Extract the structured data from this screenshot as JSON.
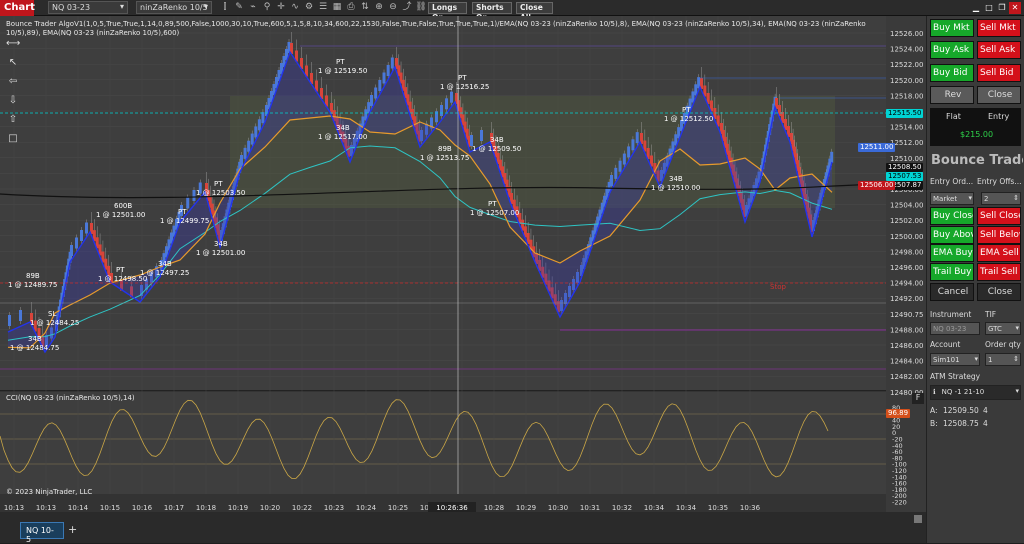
{
  "toolbar": {
    "chart_label": "Chart",
    "instrument": "NQ 03-23",
    "bar_type": "ninZaRenko 10/5",
    "longs_on": "Longs On",
    "shorts_on": "Shorts On",
    "close_all": "Close All"
  },
  "study_text": "Bounce Trader AlgoV1(1,0,5,True,True,1,14,0,89,500,False,1000,30,10,True,600,5,1,5,8,10,34,600,22,1530,False,True,False,True,True,True,1)/EMA(NQ 03-23 (ninZaRenko 10/5),8), EMA(NQ 03-23 (ninZaRenko 10/5),34), EMA(NQ 03-23 (ninZaRenko 10/5),89), EMA(NQ 03-23 (ninZaRenko 10/5),600)",
  "cci_label": "CCI(NQ 03-23 (ninZaRenko 10/5),14)",
  "copyright": "© 2023 NinjaTrader, LLC",
  "crosshair_time": "10:26:36",
  "price_axis": [
    "12526.00",
    "12524.00",
    "12522.00",
    "12520.00",
    "12518.00",
    "12516.00",
    "12514.00",
    "12512.00",
    "12510.00",
    "12508.00",
    "12506.00",
    "12504.00",
    "12502.00",
    "12500.00",
    "12498.00",
    "12496.00",
    "12494.00",
    "12492.00",
    "12490.75",
    "12488.00",
    "12486.00",
    "12484.00",
    "12482.00",
    "12480.00"
  ],
  "cci_axis": [
    "80",
    "60",
    "40",
    "20",
    "0",
    "-20",
    "-40",
    "-60",
    "-80",
    "-100",
    "-120",
    "-140",
    "-160",
    "-180",
    "-200",
    "-220"
  ],
  "cci_value": "96.89",
  "time_axis": [
    "10:13",
    "10:13",
    "10:14",
    "10:15",
    "10:16",
    "10:17",
    "10:18",
    "10:19",
    "10:20",
    "10:22",
    "10:23",
    "10:24",
    "10:25",
    "10:27",
    "10:27",
    "10:28",
    "10:29",
    "10:30",
    "10:31",
    "10:32",
    "10:34",
    "10:34",
    "10:35",
    "10:36"
  ],
  "price_tags": {
    "hline": "12515.50",
    "cur1": "12511.00",
    "cur2": "12508.50",
    "cur3": "12507.53",
    "cur4": "12507.87",
    "stop": "12506.00"
  },
  "markers": [
    {
      "t1": "PT",
      "t2": "1 @ 12519.50"
    },
    {
      "t1": "PT",
      "t2": "1 @ 12516.25"
    },
    {
      "t1": "PT",
      "t2": "1 @ 12512.50"
    },
    {
      "t1": "34B",
      "t2": "1 @ 12517.00"
    },
    {
      "t1": "89B",
      "t2": "1 @ 12513.75"
    },
    {
      "t1": "34B",
      "t2": "1 @ 12509.50"
    },
    {
      "t1": "34B",
      "t2": "1 @ 12510.00"
    },
    {
      "t1": "PT",
      "t2": "1 @ 12507.00"
    },
    {
      "t1": "PT",
      "t2": "1 @ 12503.50"
    },
    {
      "t1": "600B",
      "t2": "1 @ 12501.00"
    },
    {
      "t1": "PT",
      "t2": "1 @ 12499.75"
    },
    {
      "t1": "34B",
      "t2": "1 @ 12501.00"
    },
    {
      "t1": "PT",
      "t2": "1 @ 12498.50"
    },
    {
      "t1": "34B",
      "t2": "1 @ 12497.25"
    },
    {
      "t1": "89B",
      "t2": "1 @ 12489.75"
    },
    {
      "t1": "SL",
      "t2": "1 @ 12484.25"
    },
    {
      "t1": "34B",
      "t2": "1 @ 12484.75"
    }
  ],
  "stop_label": "Stop",
  "panel": {
    "buy_mkt": "Buy Mkt",
    "sell_mkt": "Sell Mkt",
    "buy_ask": "Buy Ask",
    "sell_ask": "Sell Ask",
    "buy_bid": "Buy Bid",
    "sell_bid": "Sell Bid",
    "rev": "Rev",
    "close": "Close",
    "flat": "Flat",
    "entry": "Entry",
    "pnl": "$215.00",
    "title": "Bounce Trader",
    "entry_order_label": "Entry Ord...",
    "entry_offset_label": "Entry Offs...",
    "entry_order_value": "Market",
    "entry_offset_value": "2",
    "buy_close": "Buy Close",
    "sell_close": "Sell Close",
    "buy_above": "Buy Above",
    "sell_below": "Sell Below",
    "ema_buy": "EMA Buy",
    "ema_sell": "EMA Sell",
    "trail_buy": "Trail Buy",
    "trail_sell": "Trail Sell",
    "cancel": "Cancel",
    "close2": "Close",
    "instrument_label": "Instrument",
    "tif_label": "TIF",
    "instrument_value": "NQ 03-23",
    "tif_value": "GTC",
    "account_label": "Account",
    "order_qty_label": "Order qty",
    "account_value": "Sim101",
    "order_qty_value": "1",
    "atm_label": "ATM Strategy",
    "atm_value": "NQ -1 21-10",
    "ask_label": "A:",
    "ask_price": "12509.50",
    "ask_size": "4",
    "bid_label": "B:",
    "bid_price": "12508.75",
    "bid_size": "4"
  },
  "bottom_tab": "NQ 10-5",
  "colors": {
    "ema8": "#2233ee",
    "ema34": "#e89b2c",
    "ema89": "#2ec4c4",
    "ema600": "#111111",
    "up": "#4a78d8",
    "down": "#d8443a"
  }
}
